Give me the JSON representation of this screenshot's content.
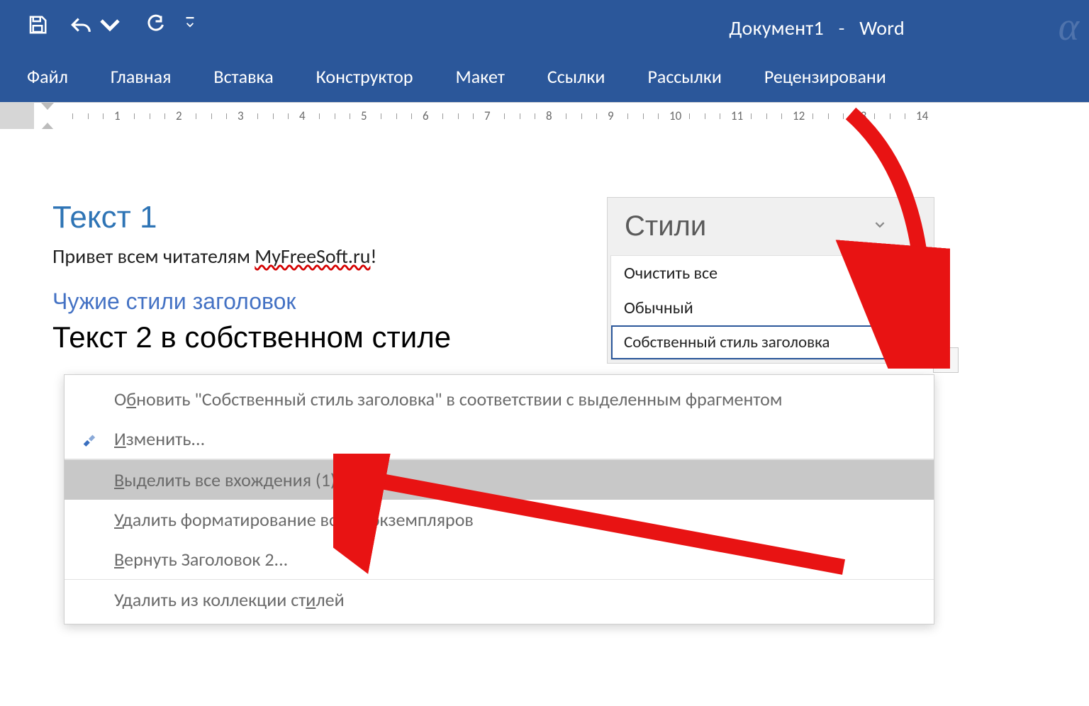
{
  "title": {
    "doc": "Документ1",
    "app": "Word"
  },
  "ribbon": {
    "tabs": [
      "Файл",
      "Главная",
      "Вставка",
      "Конструктор",
      "Макет",
      "Ссылки",
      "Рассылки",
      "Рецензировани"
    ]
  },
  "ruler": {
    "numbers": [
      1,
      2,
      3,
      4,
      5,
      6,
      7,
      8,
      9,
      10,
      11,
      12,
      13,
      14
    ]
  },
  "document": {
    "heading1": "Текст 1",
    "line1_a": "Привет всем читателям ",
    "line1_spell": "MyFreeSoft.ru",
    "line1_b": "!",
    "heading2": "Чужие стили заголовок",
    "heading3": "Текст 2 в собственном стиле"
  },
  "styles_pane": {
    "title": "Стили",
    "items": [
      {
        "label": "Очистить все",
        "pilcrow": false
      },
      {
        "label": "Обычный",
        "pilcrow": true
      },
      {
        "label": "Собственный стиль заголовка",
        "pilcrow": true,
        "selected": true
      }
    ]
  },
  "context_menu": {
    "items": [
      {
        "text": "Обновить \"Собственный стиль заголовка\" в соответствии с выделенным фрагментом",
        "u": 1
      },
      {
        "text": "Изменить...",
        "u": 0,
        "icon": "format-brush"
      },
      {
        "text": "Выделить все вхождения (1)",
        "u": 0,
        "hover": true
      },
      {
        "text": "Удалить форматирование всех 1 экземпляров",
        "u": 0
      },
      {
        "text": "Вернуть Заголовок 2...",
        "u": 0
      },
      {
        "text": "Удалить из коллекции стилей",
        "u": 23
      }
    ]
  }
}
